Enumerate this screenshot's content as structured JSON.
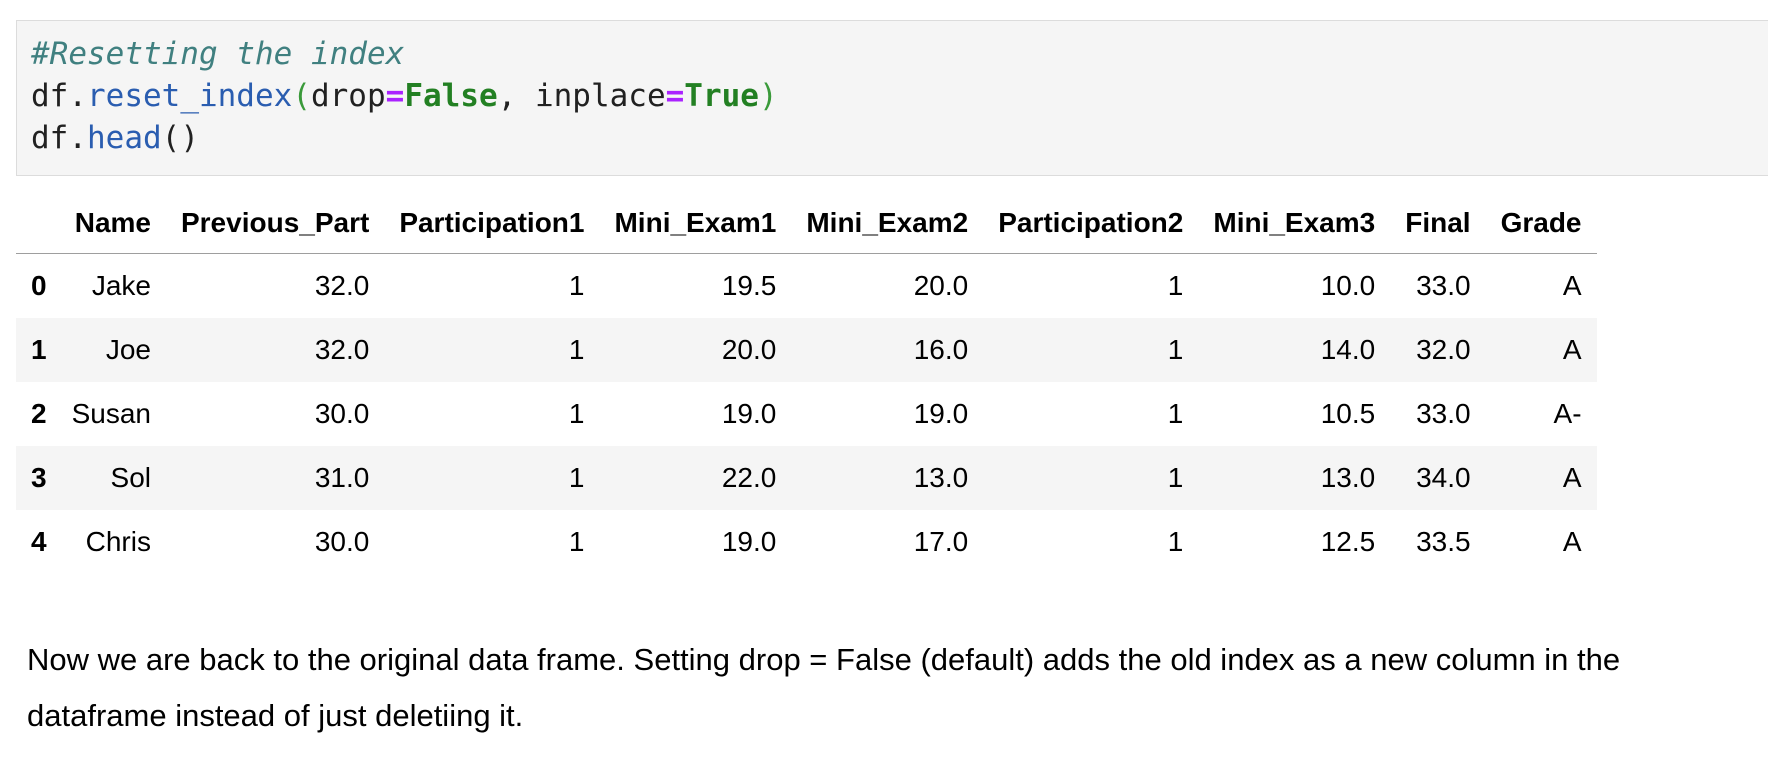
{
  "code_cell": {
    "comment": "#Resetting the index",
    "line2": {
      "obj": "df.",
      "method": "reset_index",
      "open_paren": "(",
      "arg1_name": "drop",
      "eq1": "=",
      "arg1_val": "False",
      "sep": ", ",
      "arg2_name": "inplace",
      "eq2": "=",
      "arg2_val": "True",
      "close_paren": ")"
    },
    "line3": {
      "obj": "df.",
      "method": "head",
      "parens": "()"
    }
  },
  "table": {
    "index_header": "",
    "columns": [
      "Name",
      "Previous_Part",
      "Participation1",
      "Mini_Exam1",
      "Mini_Exam2",
      "Participation2",
      "Mini_Exam3",
      "Final",
      "Grade"
    ],
    "rows": [
      {
        "index": "0",
        "cells": [
          "Jake",
          "32.0",
          "1",
          "19.5",
          "20.0",
          "1",
          "10.0",
          "33.0",
          "A"
        ]
      },
      {
        "index": "1",
        "cells": [
          "Joe",
          "32.0",
          "1",
          "20.0",
          "16.0",
          "1",
          "14.0",
          "32.0",
          "A"
        ]
      },
      {
        "index": "2",
        "cells": [
          "Susan",
          "30.0",
          "1",
          "19.0",
          "19.0",
          "1",
          "10.5",
          "33.0",
          "A-"
        ]
      },
      {
        "index": "3",
        "cells": [
          "Sol",
          "31.0",
          "1",
          "22.0",
          "13.0",
          "1",
          "13.0",
          "34.0",
          "A"
        ]
      },
      {
        "index": "4",
        "cells": [
          "Chris",
          "30.0",
          "1",
          "19.0",
          "17.0",
          "1",
          "12.5",
          "33.5",
          "A"
        ]
      }
    ]
  },
  "markdown": {
    "text": "Now we are back to the original data frame. Setting drop = False (default) adds the old index as a new column in the dataframe instead of just deletiing it."
  }
}
